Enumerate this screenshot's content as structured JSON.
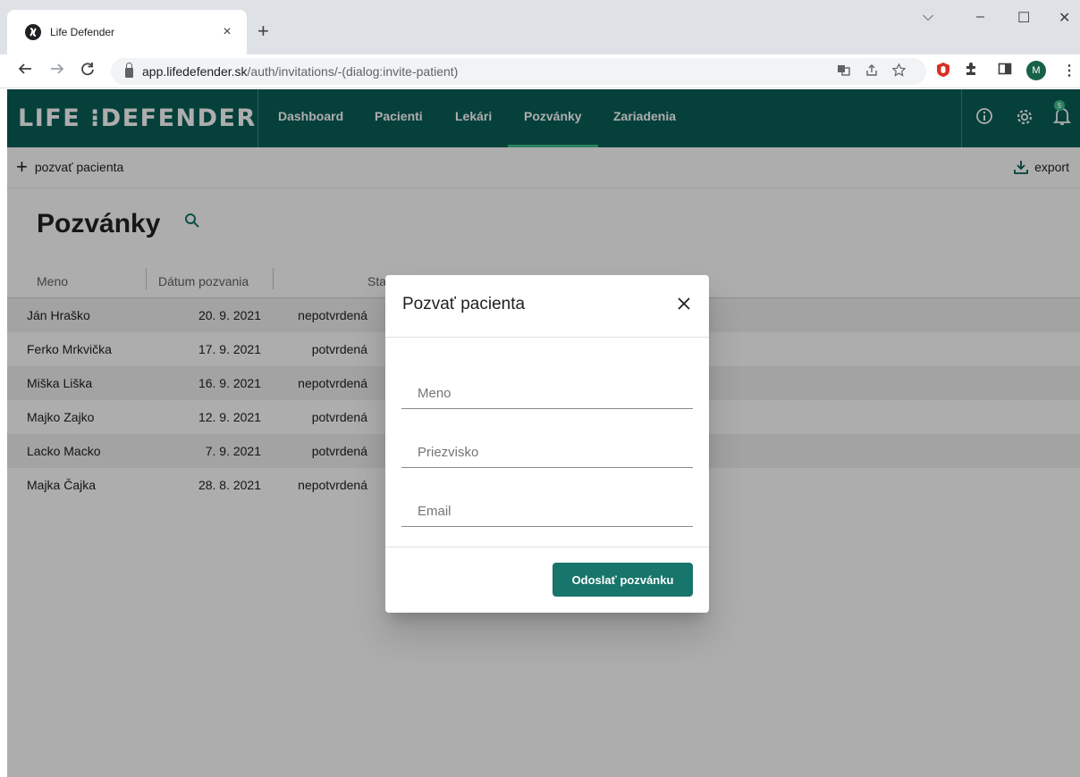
{
  "browser": {
    "tab_title": "Life Defender",
    "tab_close": "×",
    "new_tab": "+",
    "window_controls": {
      "chevron": "⌵",
      "minimize": "–",
      "maximize": "☐",
      "close": "✕"
    },
    "url_host": "app.lifedefender.sk",
    "url_path": "/auth/invitations/-(dialog:invite-patient)",
    "profile_initial": "M",
    "icons": [
      "back-icon",
      "forward-icon",
      "reload-icon",
      "lock-icon",
      "translate-icon",
      "share-icon",
      "star-icon",
      "opera-icon",
      "extensions-icon",
      "sidepanel-icon",
      "profile-avatar",
      "menu-icon"
    ]
  },
  "app": {
    "logo": "LIFE ⁝DEFENDER",
    "nav": [
      "Dashboard",
      "Pacienti",
      "Lekári",
      "Pozvánky",
      "Zariadenia"
    ],
    "active_nav": "Pozvánky",
    "notification_count": "5",
    "colors": {
      "header": "#0a5f58",
      "accent": "#3cc08e",
      "button": "#17756b"
    }
  },
  "actions": {
    "invite": "pozvať pacienta",
    "export": "export"
  },
  "page": {
    "title": "Pozvánky",
    "columns": [
      "Meno",
      "Dátum pozvania",
      "Stav"
    ],
    "rows": [
      {
        "name": "Ján Hraško",
        "date": "20. 9. 2021",
        "status": "nepotvrdená"
      },
      {
        "name": "Ferko Mrkvička",
        "date": "17. 9. 2021",
        "status": "potvrdená"
      },
      {
        "name": "Miška Liška",
        "date": "16. 9. 2021",
        "status": "nepotvrdená"
      },
      {
        "name": "Majko Zajko",
        "date": "12. 9. 2021",
        "status": "potvrdená"
      },
      {
        "name": "Lacko Macko",
        "date": "7. 9. 2021",
        "status": "potvrdená"
      },
      {
        "name": "Majka Čajka",
        "date": "28. 8. 2021",
        "status": "nepotvrdená"
      }
    ]
  },
  "dialog": {
    "title": "Pozvať pacienta",
    "fields": {
      "first_name": "Meno",
      "last_name": "Priezvisko",
      "email": "Email"
    },
    "submit": "Odoslať pozvánku"
  }
}
